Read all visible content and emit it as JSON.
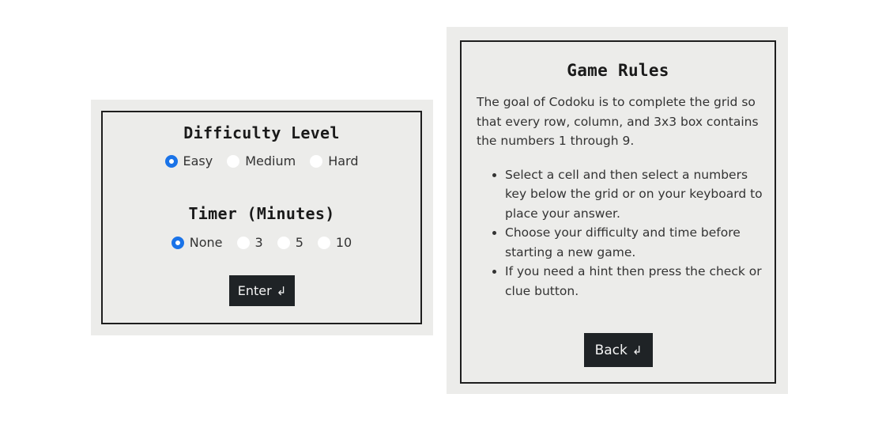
{
  "settings": {
    "difficulty_title": "Difficulty Level",
    "difficulty_options": [
      {
        "label": "Easy",
        "checked": true
      },
      {
        "label": "Medium",
        "checked": false
      },
      {
        "label": "Hard",
        "checked": false
      }
    ],
    "timer_title": "Timer (Minutes)",
    "timer_options": [
      {
        "label": "None",
        "checked": true
      },
      {
        "label": "3",
        "checked": false
      },
      {
        "label": "5",
        "checked": false
      },
      {
        "label": "10",
        "checked": false
      }
    ],
    "enter_label": "Enter",
    "enter_icon": "↲"
  },
  "rules": {
    "title": "Game Rules",
    "intro": "The goal of Codoku is to complete the grid so that every row, column, and 3x3 box contains the numbers 1 through 9.",
    "items": [
      "Select a cell and then select a numbers key below the grid or on your keyboard to place your answer.",
      "Choose your difficulty and time before starting a new game.",
      "If you need a hint then press the check or clue button."
    ],
    "back_label": "Back",
    "back_icon": "↲"
  },
  "colors": {
    "card_bg": "#ececea",
    "button_bg": "#1f2326",
    "radio_checked": "#1a73e8"
  }
}
